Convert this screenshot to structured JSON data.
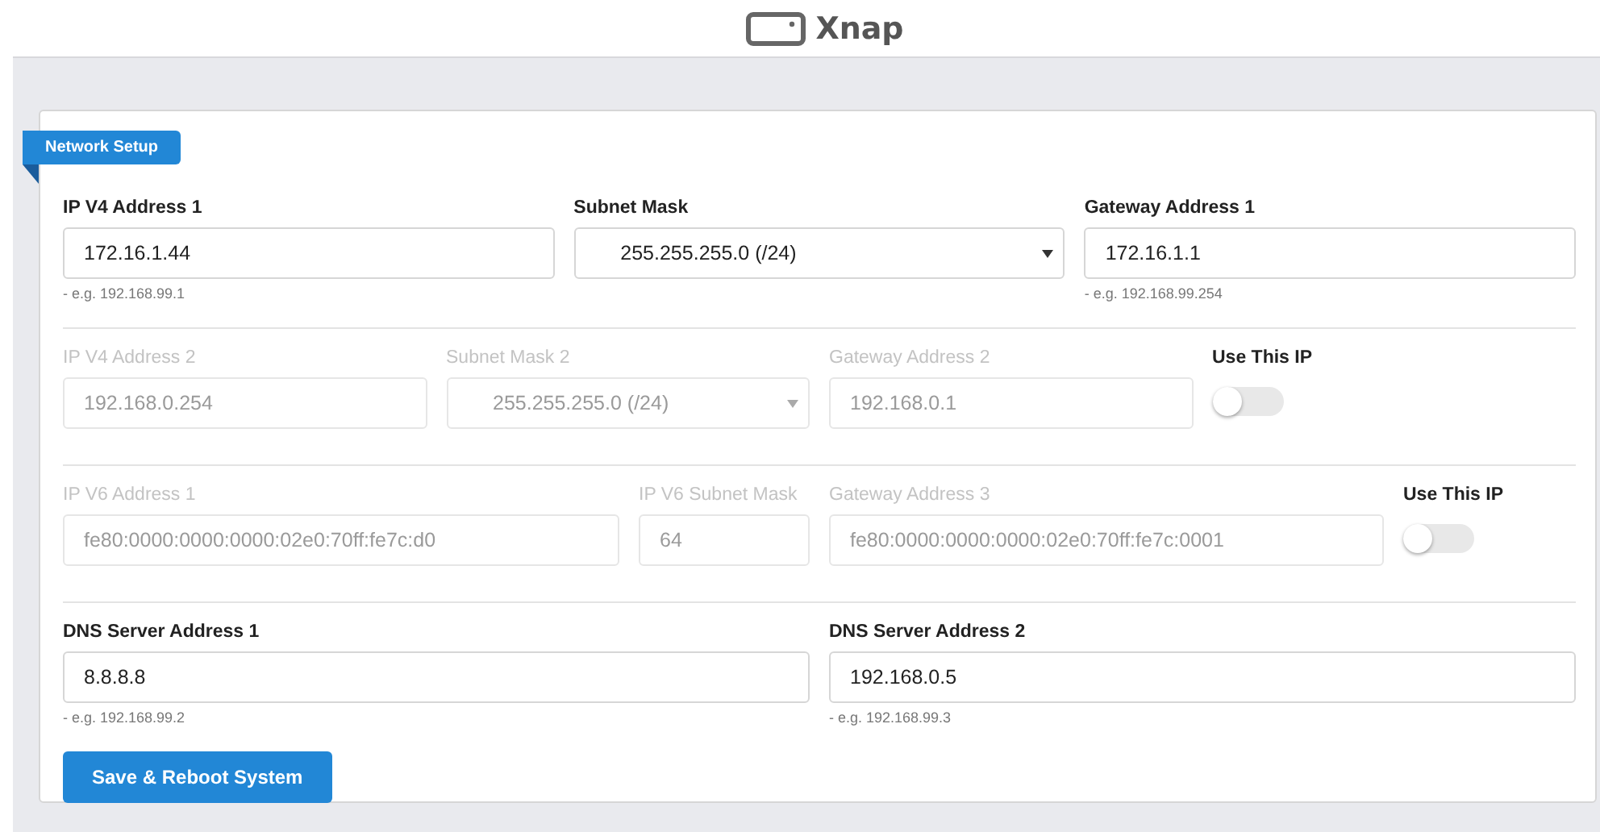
{
  "header": {
    "brand": "Xnap"
  },
  "panel": {
    "title": "Network Setup"
  },
  "rows": [
    {
      "fields": [
        {
          "kind": "input",
          "label": "IP V4 Address 1",
          "value": "172.16.1.44",
          "hint": "- e.g. 192.168.99.1",
          "disabled": false
        },
        {
          "kind": "select",
          "label": "Subnet Mask",
          "value": "255.255.255.0 (/24)",
          "disabled": false
        },
        {
          "kind": "input",
          "label": "Gateway Address 1",
          "value": "172.16.1.1",
          "hint": "- e.g. 192.168.99.254",
          "disabled": false
        }
      ]
    },
    {
      "fields": [
        {
          "kind": "input",
          "label": "IP V4 Address 2",
          "value": "192.168.0.254",
          "disabled": true
        },
        {
          "kind": "select",
          "label": "Subnet Mask 2",
          "value": "255.255.255.0 (/24)",
          "disabled": true
        },
        {
          "kind": "input",
          "label": "Gateway Address 2",
          "value": "192.168.0.1",
          "disabled": true
        },
        {
          "kind": "toggle",
          "label": "Use This IP",
          "on": false
        }
      ]
    },
    {
      "fields": [
        {
          "kind": "input",
          "label": "IP V6 Address 1",
          "value": "fe80:0000:0000:0000:02e0:70ff:fe7c:d0",
          "disabled": true
        },
        {
          "kind": "input",
          "label": "IP V6 Subnet Mask",
          "value": "64",
          "disabled": true
        },
        {
          "kind": "input",
          "label": "Gateway Address 3",
          "value": "fe80:0000:0000:0000:02e0:70ff:fe7c:0001",
          "disabled": true
        },
        {
          "kind": "toggle",
          "label": "Use This IP",
          "on": false
        }
      ]
    },
    {
      "fields": [
        {
          "kind": "input",
          "label": "DNS Server Address 1",
          "value": "8.8.8.8",
          "hint": "- e.g. 192.168.99.2",
          "disabled": false
        },
        {
          "kind": "input",
          "label": "DNS Server Address 2",
          "value": "192.168.0.5",
          "hint": "- e.g. 192.168.99.3",
          "disabled": false
        }
      ]
    }
  ],
  "save_button": "Save & Reboot System"
}
